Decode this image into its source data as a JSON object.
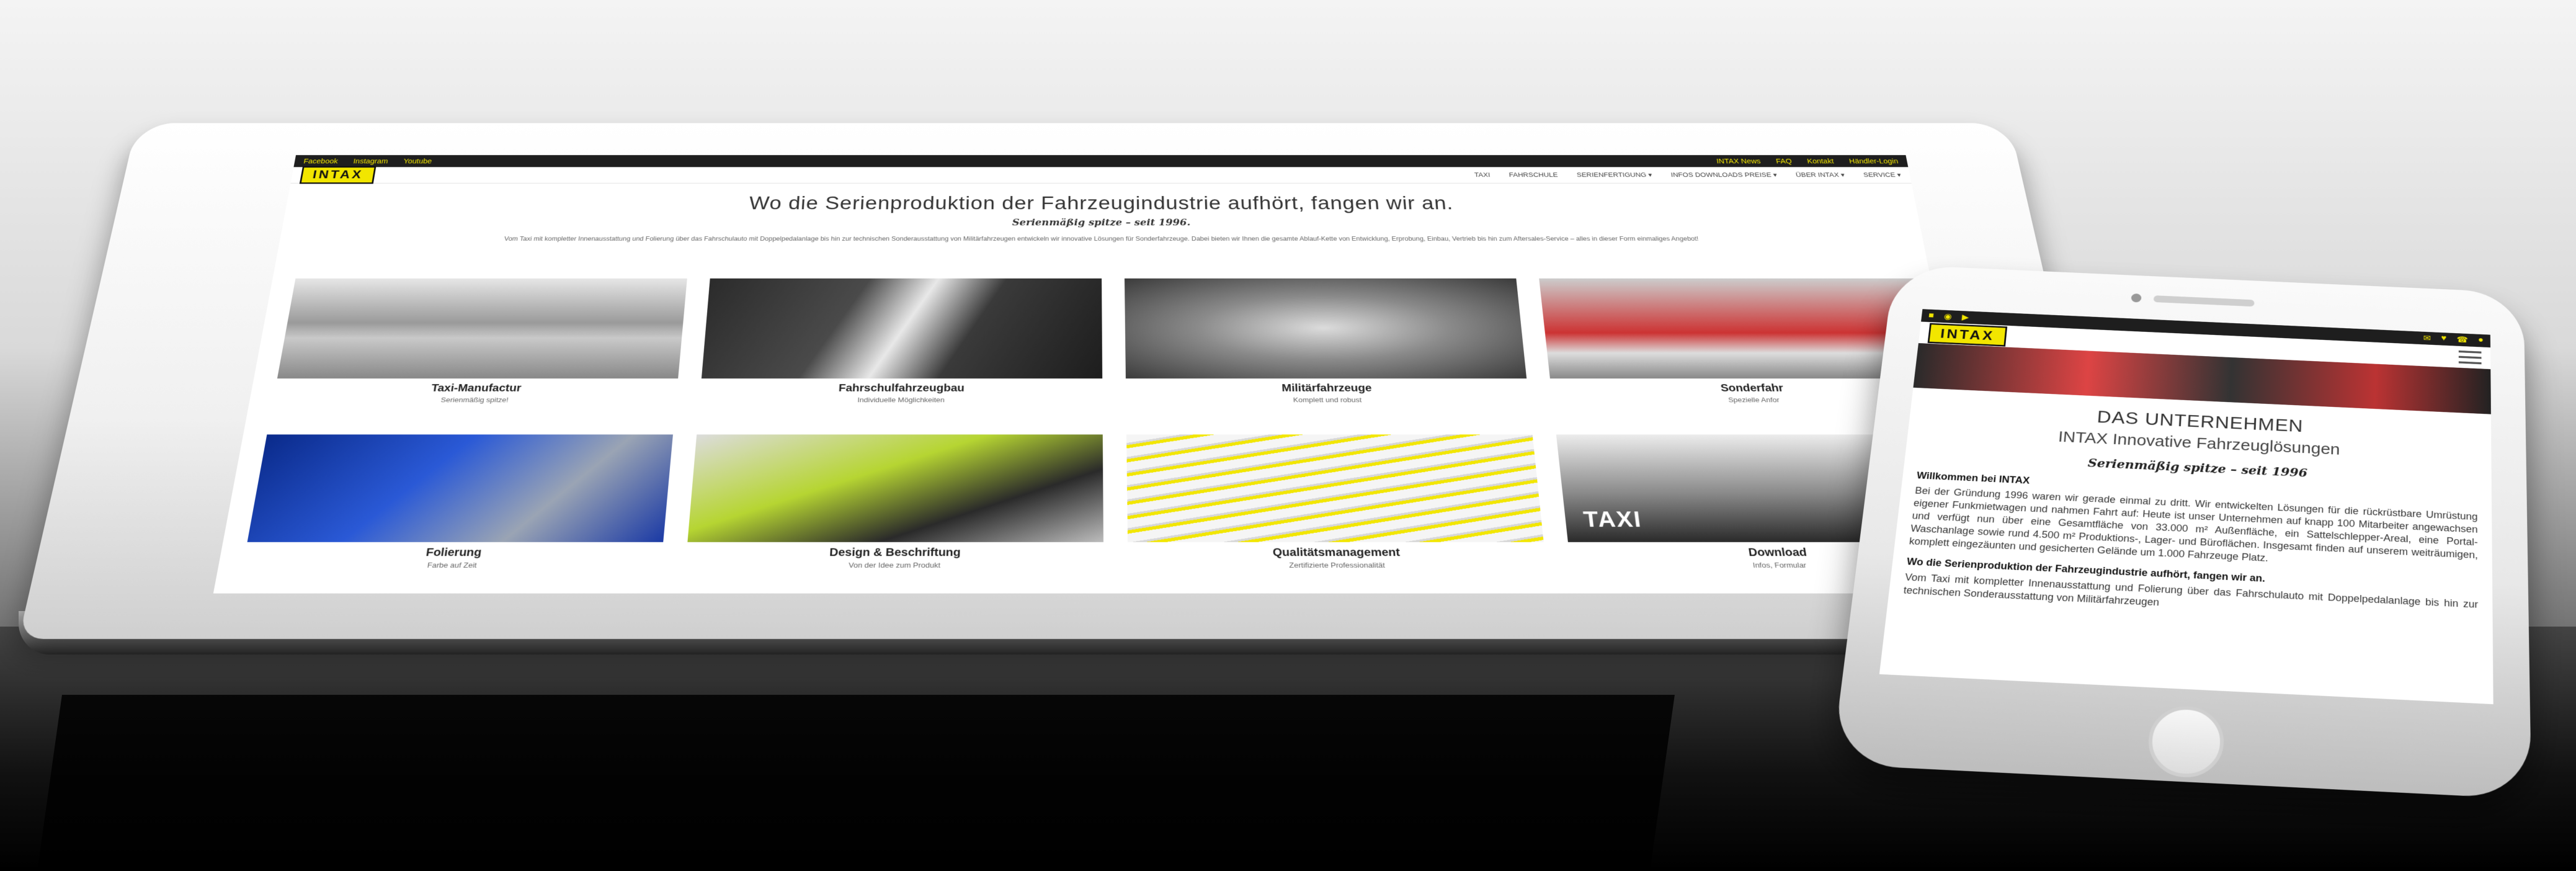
{
  "tablet_site": {
    "topbar_left": [
      "Facebook",
      "Instagram",
      "Youtube"
    ],
    "topbar_right": [
      "INTAX News",
      "FAQ",
      "Kontakt",
      "Händler-Login"
    ],
    "logo": "INTAX",
    "menu": [
      "TAXI",
      "FAHRSCHULE",
      "SERIENFERTIGUNG ▾",
      "INFOS DOWNLOADS PREISE ▾",
      "ÜBER INTAX ▾",
      "SERVICE ▾"
    ],
    "headline": "Wo die Serienproduktion der Fahrzeugindustrie aufhört, fangen wir an.",
    "subline": "Serienmäßig spitze – seit 1996.",
    "intro": "Vom Taxi mit kompletter Innenausstattung und Folierung über das Fahrschulauto mit Doppelpedalanlage bis hin zur technischen Sonderausstattung von Militärfahrzeugen entwickeln wir innovative Lösungen für Sonderfahrzeuge. Dabei bieten wir Ihnen die gesamte Ablauf-Kette von Entwicklung, Erprobung, Einbau, Vertrieb bis hin zum Aftersales-Service – alles in dieser Form einmaliges Angebot!",
    "tiles": [
      {
        "title": "Taxi-Manufactur",
        "sub": "Serienmäßig spitze!"
      },
      {
        "title": "Fahrschulfahrzeugbau",
        "sub": "Individuelle Möglichkeiten"
      },
      {
        "title": "Militärfahrzeuge",
        "sub": "Komplett und robust"
      },
      {
        "title": "Sonderfahr",
        "sub": "Spezielle Anfor"
      },
      {
        "title": "Folierung",
        "sub": "Farbe auf Zeit"
      },
      {
        "title": "Design & Beschriftung",
        "sub": "Von der Idee zum Produkt"
      },
      {
        "title": "Qualitätsmanagement",
        "sub": "Zertifizierte Professionalität"
      },
      {
        "title": "Download",
        "sub": "Infos, Formular"
      }
    ],
    "download_tile_text": "TAXI"
  },
  "phone_site": {
    "logo": "INTAX",
    "h1": "DAS UNTERNEHMEN",
    "h2": "INTAX Innovative Fahrzeuglösungen",
    "sub": "Serienmäßig spitze – seit 1996",
    "h3_1": "Willkommen bei INTAX",
    "body_1": "Bei der Gründung 1996 waren wir gerade einmal zu dritt. Wir entwickelten Lösungen für die rückrüstbare Umrüstung eigener Funkmietwagen und nahmen Fahrt auf: Heute ist unser Unternehmen auf knapp 100 Mitarbeiter angewachsen und verfügt nun über eine Gesamtfläche von 33.000 m² Außenfläche, ein Sattelschlepper-Areal, eine Portal-Waschanlage sowie rund 4.500 m² Produktions-, Lager- und Büroflächen. Insgesamt finden auf unserem weiträumigen, komplett eingezäunten und gesicherten Gelände um 1.000 Fahrzeuge Platz.",
    "h3_2": "Wo die Serienproduktion der Fahrzeugindustrie aufhört, fangen wir an.",
    "body_2": "Vom Taxi mit kompletter Innenausstattung und Folierung über das Fahrschulauto mit Doppelpedalanlage bis hin zur technischen Sonderausstattung von Militärfahrzeugen"
  },
  "colors": {
    "brand_yellow": "#f2e600",
    "bar_dark": "#1e1e1e"
  }
}
